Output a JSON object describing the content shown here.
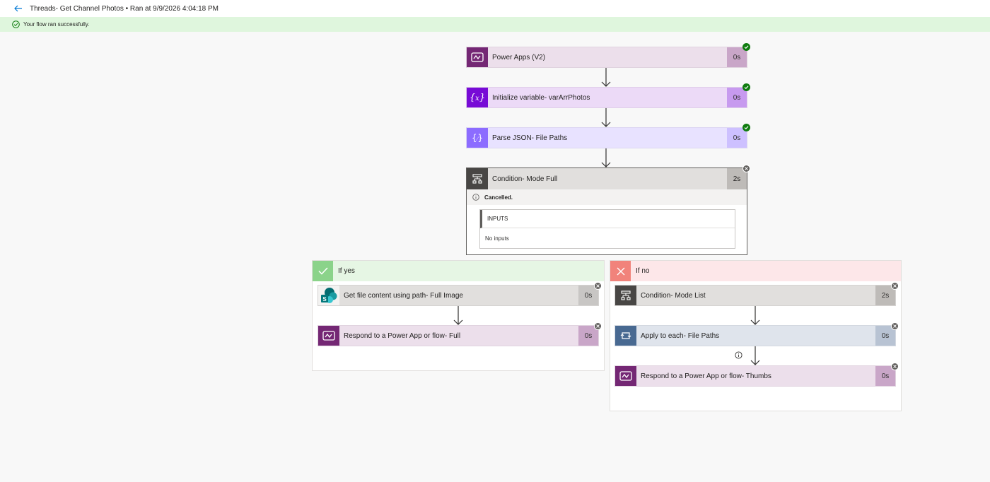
{
  "header": {
    "title": "Threads- Get Channel Photos • Ran at 9/9/2026 4:04:18 PM",
    "status_message": "Your flow ran successfully."
  },
  "colors": {
    "power_apps": "#742774",
    "variable": "#770bd6",
    "parse_json": "#8c6cff",
    "condition": "#484644",
    "apply_each": "#486991",
    "success": "#107c10",
    "yes_branch": "#8bd38a",
    "no_branch": "#f1837b"
  },
  "steps": {
    "power_apps": {
      "label": "Power Apps (V2)",
      "duration": "0s",
      "icon": "power-apps-icon",
      "status": "succeeded"
    },
    "init_var": {
      "label": "Initialize variable- varArrPhotos",
      "duration": "0s",
      "icon": "variable-icon",
      "status": "succeeded"
    },
    "parse_json": {
      "label": "Parse JSON- File Paths",
      "duration": "0s",
      "icon": "parse-json-icon",
      "status": "succeeded"
    },
    "condition_full": {
      "label": "Condition- Mode Full",
      "duration": "2s",
      "icon": "condition-icon",
      "status": "cancelled",
      "status_text": "Cancelled.",
      "inputs_header": "INPUTS",
      "inputs_value": "No inputs"
    }
  },
  "branch_yes": {
    "label": "If yes",
    "steps": [
      {
        "label": "Get file content using path- Full Image",
        "duration": "0s",
        "icon": "sharepoint-icon",
        "status": "cancelled"
      },
      {
        "label": "Respond to a Power App or flow- Full",
        "duration": "0s",
        "icon": "power-apps-icon",
        "status": "cancelled"
      }
    ]
  },
  "branch_no": {
    "label": "If no",
    "steps": [
      {
        "label": "Condition- Mode List",
        "duration": "2s",
        "icon": "condition-icon",
        "status": "cancelled"
      },
      {
        "label": "Apply to each- File Paths",
        "duration": "0s",
        "icon": "loop-icon",
        "status": "cancelled"
      },
      {
        "label": "Respond to a Power App or flow- Thumbs",
        "duration": "0s",
        "icon": "power-apps-icon",
        "status": "cancelled"
      }
    ]
  }
}
